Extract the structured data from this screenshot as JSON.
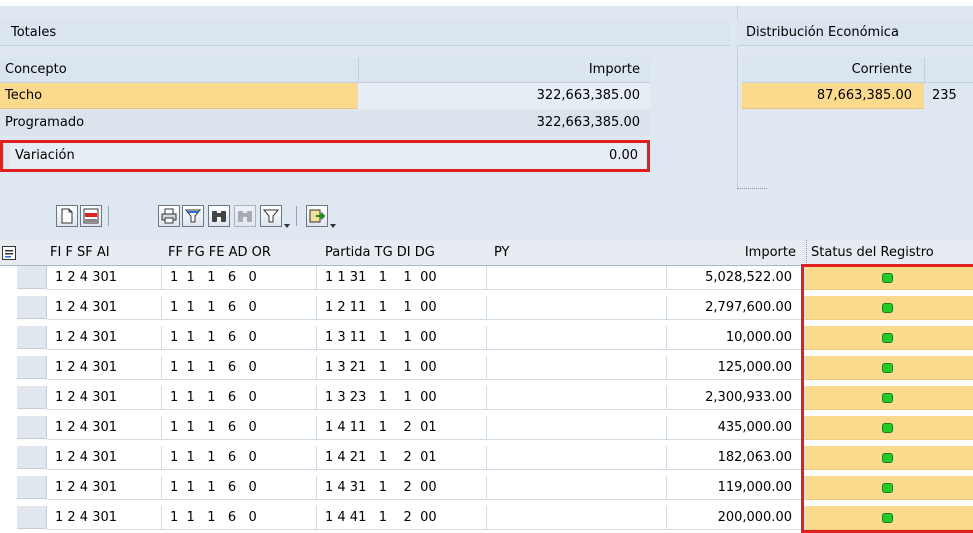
{
  "totales": {
    "title": "Totales",
    "col_concepto": "Concepto",
    "col_importe": "Importe",
    "rows": [
      {
        "concepto": "Techo",
        "importe": "322,663,385.00"
      },
      {
        "concepto": "Programado",
        "importe": "322,663,385.00"
      },
      {
        "concepto": "Variación",
        "importe": "0.00"
      }
    ]
  },
  "distribucion": {
    "title": "Distribución Económica",
    "col_corriente": "Corriente",
    "corriente_value": "87,663,385.00",
    "next_value_partial": "235"
  },
  "toolbar": {
    "icons": [
      "details-icon",
      "delete-row-icon",
      "print-icon",
      "filter-icon",
      "find-icon",
      "find-next-icon",
      "set-filter-icon",
      "export-icon"
    ]
  },
  "grid": {
    "headers": {
      "col1": "FI F SF AI",
      "col2": "FF FG FE AD OR",
      "col3": "Partida TG DI DG",
      "col4": "PY",
      "col5": "Importe",
      "col6": "Status del Registro"
    },
    "rows": [
      {
        "c1": "1 2 4 301",
        "c2": "1  1   1   6   0",
        "c3": "1 1 31   1    1  00",
        "importe": "5,028,522.00"
      },
      {
        "c1": "1 2 4 301",
        "c2": "1  1   1   6   0",
        "c3": "1 2 11   1    1  00",
        "importe": "2,797,600.00"
      },
      {
        "c1": "1 2 4 301",
        "c2": "1  1   1   6   0",
        "c3": "1 3 11   1    1  00",
        "importe": "10,000.00"
      },
      {
        "c1": "1 2 4 301",
        "c2": "1  1   1   6   0",
        "c3": "1 3 21   1    1  00",
        "importe": "125,000.00"
      },
      {
        "c1": "1 2 4 301",
        "c2": "1  1   1   6   0",
        "c3": "1 3 23   1    1  00",
        "importe": "2,300,933.00"
      },
      {
        "c1": "1 2 4 301",
        "c2": "1  1   1   6   0",
        "c3": "1 4 11   1    2  01",
        "importe": "435,000.00"
      },
      {
        "c1": "1 2 4 301",
        "c2": "1  1   1   6   0",
        "c3": "1 4 21   1    2  01",
        "importe": "182,063.00"
      },
      {
        "c1": "1 2 4 301",
        "c2": "1  1   1   6   0",
        "c3": "1 4 31   1    2  00",
        "importe": "119,000.00"
      },
      {
        "c1": "1 2 4 301",
        "c2": "1  1   1   6   0",
        "c3": "1 4 41   1    2  00",
        "importe": "200,000.00"
      }
    ]
  },
  "colors": {
    "highlight_red": "#e02020",
    "status_yellow": "#fbd98d",
    "status_green": "#22cc22",
    "techo_orange": "#fbd98d"
  }
}
